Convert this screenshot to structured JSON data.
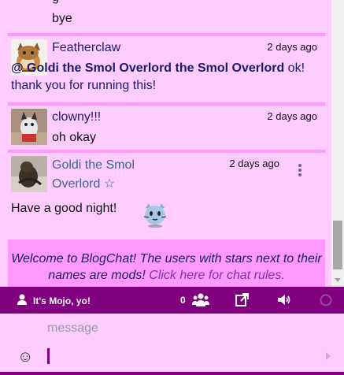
{
  "messages": [
    {
      "text": "bye",
      "cut_text": "g"
    },
    {
      "username": "Featherclaw",
      "time": "2 days ago",
      "mention": "@ Goldi the Smol Overlord the Smol Overlord",
      "text": " ok! thank you for running this!"
    },
    {
      "username": "clowny!!!",
      "time": "2 days ago",
      "text": "oh okay"
    },
    {
      "username": "Goldi the Smol Overlord",
      "username_line1": "Goldi the Smol",
      "username_line2": "Overlord",
      "star": "☆",
      "time": "2 days ago",
      "text": "Have a good night!",
      "emoji_icon": "cat-emoji-icon"
    }
  ],
  "welcome": {
    "text": "Welcome to BlogChat! The users with stars next to their names are mods! ",
    "link": "Click here for chat rules."
  },
  "toolbar": {
    "user_label": "It's Mojo, yo!",
    "user_count": "0",
    "icons": [
      "user-icon",
      "users-icon",
      "external-link-icon",
      "volume-icon",
      "status-circle-icon"
    ]
  },
  "input": {
    "placeholder": "message",
    "value": ""
  },
  "colors": {
    "background": "#ff99ff",
    "message_bg": "#ffccff",
    "toolbar": "#800080",
    "mod_name": "#336699",
    "link": "#7a33aa"
  }
}
